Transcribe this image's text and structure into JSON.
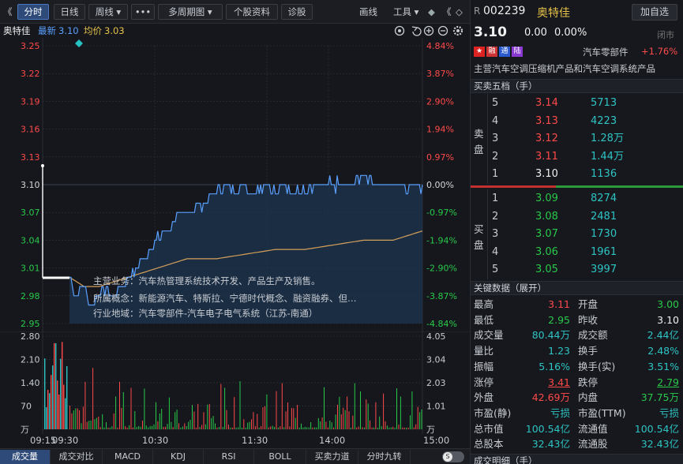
{
  "toolbar": {
    "nav_left": "《",
    "tabs": [
      "分时",
      "日线",
      "周线 ▾",
      "•••",
      "多周期图 ▾",
      "个股资料",
      "诊股"
    ],
    "right_items": [
      "画线",
      "工具 ▾",
      "◆",
      "《",
      "◇"
    ]
  },
  "header": {
    "name": "奥特佳",
    "latest_label": "最新",
    "latest": "3.10",
    "avg_label": "均价",
    "avg": "3.03",
    "icons": [
      "target-icon",
      "undo-icon",
      "zoom-in-icon",
      "zoom-out-icon",
      "settings-icon"
    ]
  },
  "chart": {
    "price_ticks": [
      "3.25",
      "3.22",
      "3.19",
      "3.16",
      "3.13",
      "3.10",
      "3.07",
      "3.04",
      "3.01",
      "2.98",
      "2.95"
    ],
    "pct_ticks": [
      "4.84%",
      "3.87%",
      "2.90%",
      "1.94%",
      "0.97%",
      "0.00%",
      "-0.97%",
      "-1.94%",
      "-2.90%",
      "-3.87%",
      "-4.84%"
    ],
    "price_range": [
      2.95,
      3.25
    ],
    "prev_close": 3.1,
    "info_lines": [
      "主营业务：汽车热管理系统技术开发、产品生产及销售。",
      "所属概念：新能源汽车、特斯拉、宁德时代概念、融资融券、但…",
      "行业地域：汽车零部件-汽车电子电气系统（江苏-南通）"
    ]
  },
  "chart_data": {
    "type": "line",
    "series": [
      {
        "name": "最新",
        "color": "#5aa0ff"
      },
      {
        "name": "均价",
        "color": "#d4a05a"
      }
    ],
    "price_keypoints": [
      [
        0,
        3.0
      ],
      [
        5,
        2.98
      ],
      [
        10,
        2.99
      ],
      [
        15,
        2.97
      ],
      [
        20,
        2.98
      ],
      [
        25,
        2.99
      ],
      [
        30,
        2.98
      ],
      [
        40,
        3.0
      ],
      [
        50,
        3.02
      ],
      [
        60,
        3.04
      ],
      [
        70,
        3.06
      ],
      [
        80,
        3.07
      ],
      [
        90,
        3.08
      ],
      [
        100,
        3.09
      ],
      [
        105,
        3.1
      ],
      [
        110,
        3.09
      ],
      [
        115,
        3.1
      ],
      [
        120,
        3.1
      ],
      [
        125,
        3.09
      ],
      [
        130,
        3.1
      ],
      [
        135,
        3.1
      ],
      [
        140,
        3.09
      ],
      [
        145,
        3.1
      ],
      [
        150,
        3.1
      ],
      [
        160,
        3.09
      ],
      [
        170,
        3.1
      ],
      [
        180,
        3.1
      ],
      [
        190,
        3.1
      ],
      [
        200,
        3.11
      ],
      [
        210,
        3.1
      ],
      [
        220,
        3.1
      ],
      [
        230,
        3.1
      ],
      [
        240,
        3.1
      ]
    ],
    "avg_keypoints": [
      [
        0,
        3.0
      ],
      [
        10,
        2.99
      ],
      [
        20,
        2.99
      ],
      [
        40,
        3.0
      ],
      [
        60,
        3.01
      ],
      [
        80,
        3.02
      ],
      [
        100,
        3.02
      ],
      [
        120,
        3.025
      ],
      [
        140,
        3.03
      ],
      [
        160,
        3.03
      ],
      [
        180,
        3.035
      ],
      [
        200,
        3.04
      ],
      [
        220,
        3.04
      ],
      [
        240,
        3.05
      ]
    ],
    "volume_ticks_left": [
      "2.80",
      "2.10",
      "1.40",
      "70",
      "万"
    ],
    "volume_ticks_right": [
      "4.05",
      "3.04",
      "2.03",
      "1.01",
      "万"
    ],
    "volume_max": 2.8,
    "time_labels": [
      "09:15",
      "09:30",
      "10:30",
      "11:30",
      "14:00",
      "15:00"
    ]
  },
  "bottom_tabs": [
    "成交量",
    "成交对比",
    "MACD",
    "KDJ",
    "RSI",
    "BOLL",
    "买卖力道",
    "分时九转"
  ],
  "toggle_label": "S",
  "right_panel": {
    "code_prefix": "R",
    "code": "002239",
    "name": "奥特佳",
    "watch_button": "加自选",
    "price": "3.10",
    "change": "0.00",
    "change_pct": "0.00%",
    "status": "闭市",
    "badges": [
      "融",
      "通",
      "陆"
    ],
    "industry": "汽车零部件",
    "industry_change": "+1.76%",
    "main_business": "主营汽车空调压缩机产品和汽车空调系统产品",
    "orderbook_title": "买卖五档（手）",
    "sell_label": [
      "卖",
      "盘"
    ],
    "buy_label": [
      "买",
      "盘"
    ],
    "asks": [
      {
        "level": "5",
        "price": "3.14",
        "vol": "5713"
      },
      {
        "level": "4",
        "price": "3.13",
        "vol": "4223"
      },
      {
        "level": "3",
        "price": "3.12",
        "vol": "1.28万"
      },
      {
        "level": "2",
        "price": "3.11",
        "vol": "1.44万"
      },
      {
        "level": "1",
        "price": "3.10",
        "vol": "1136"
      }
    ],
    "bids": [
      {
        "level": "1",
        "price": "3.09",
        "vol": "8274"
      },
      {
        "level": "2",
        "price": "3.08",
        "vol": "2481"
      },
      {
        "level": "3",
        "price": "3.07",
        "vol": "1730"
      },
      {
        "level": "4",
        "price": "3.06",
        "vol": "1961"
      },
      {
        "level": "5",
        "price": "3.05",
        "vol": "3997"
      }
    ],
    "keydata_title": "关键数据（展开）",
    "keydata": [
      [
        "最高",
        "3.11",
        "开盘",
        "3.00"
      ],
      [
        "最低",
        "2.95",
        "昨收",
        "3.10"
      ],
      [
        "成交量",
        "80.44万",
        "成交额",
        "2.44亿"
      ],
      [
        "量比",
        "1.23",
        "换手",
        "2.48%"
      ],
      [
        "振幅",
        "5.16%",
        "换手(实)",
        "3.51%"
      ],
      [
        "涨停",
        "3.41",
        "跌停",
        "2.79"
      ],
      [
        "外盘",
        "42.69万",
        "内盘",
        "37.75万"
      ],
      [
        "市盈(静)",
        "亏损",
        "市盈(TTM)",
        "亏损"
      ],
      [
        "总市值",
        "100.54亿",
        "流通值",
        "100.54亿"
      ],
      [
        "总股本",
        "32.43亿",
        "流通股",
        "32.43亿"
      ]
    ],
    "trades_title": "成交明细（手）"
  }
}
